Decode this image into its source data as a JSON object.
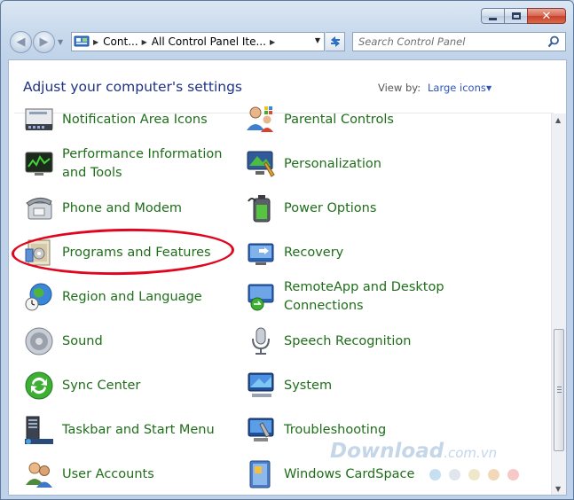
{
  "window": {
    "caption": {
      "minimize": "minimize-icon",
      "maximize": "maximize-icon",
      "close": "close-icon"
    }
  },
  "nav": {
    "back_icon": "arrow-left-icon",
    "forward_icon": "arrow-right-icon"
  },
  "address": {
    "crumb1": "Cont...",
    "crumb2": "All Control Panel Ite..."
  },
  "search": {
    "placeholder": "Search Control Panel"
  },
  "content": {
    "heading": "Adjust your computer's settings",
    "view_by_label": "View by:",
    "view_by_value": "Large icons"
  },
  "items_left": [
    {
      "label": "Notification Area Icons"
    },
    {
      "label": "Performance Information and Tools"
    },
    {
      "label": "Phone and Modem"
    },
    {
      "label": "Programs and Features"
    },
    {
      "label": "Region and Language"
    },
    {
      "label": "Sound"
    },
    {
      "label": "Sync Center"
    },
    {
      "label": "Taskbar and Start Menu"
    },
    {
      "label": "User Accounts"
    }
  ],
  "items_right": [
    {
      "label": "Parental Controls"
    },
    {
      "label": "Personalization"
    },
    {
      "label": "Power Options"
    },
    {
      "label": "Recovery"
    },
    {
      "label": "RemoteApp and Desktop Connections"
    },
    {
      "label": "Speech Recognition"
    },
    {
      "label": "System"
    },
    {
      "label": "Troubleshooting"
    },
    {
      "label": "Windows CardSpace"
    }
  ],
  "watermark": {
    "brand": "Download",
    "suffix": ".com.vn"
  },
  "colors": {
    "link_green": "#1f6e1a",
    "heading_blue": "#1e3287",
    "highlight_red": "#e0061f",
    "dots": [
      "#c6dff3",
      "#e1e6ec",
      "#efe7c9",
      "#f2d8b8",
      "#f7c8c8"
    ]
  }
}
